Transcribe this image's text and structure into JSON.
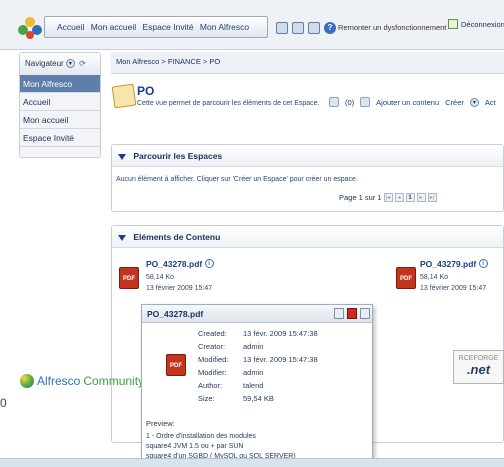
{
  "header": {
    "nav_links": [
      "Accueil",
      "Mon accueil",
      "Espace Invité",
      "Mon Alfresco"
    ],
    "report_link": "Remonter un dysfonctionnement",
    "logout_link": "Déconnexion"
  },
  "sidebar": {
    "navigator_label": "Navigateur",
    "items": [
      {
        "label": "Mon Alfresco",
        "active": true
      },
      {
        "label": "Accueil",
        "active": false
      },
      {
        "label": "Mon accueil",
        "active": false
      },
      {
        "label": "Espace Invité",
        "active": false
      }
    ]
  },
  "breadcrumb": "Mon Alfresco > FINANCE > PO",
  "space": {
    "title": "PO",
    "description": "Cette vue permet de parcourir les éléments de cet Espace.",
    "count": "(0)",
    "add_content": "Ajouter un contenu",
    "create": "Créer",
    "more": "Act"
  },
  "browse": {
    "title": "Parcourir les Espaces",
    "empty": "Aucun élément à afficher. Cliquer sur 'Créer un Espace' pour créer un espace.",
    "pager": "Page 1 sur 1"
  },
  "content": {
    "title": "Eléments de Contenu",
    "files": [
      {
        "name": "PO_43278.pdf",
        "size": "58,14 Ko",
        "date": "13 février 2009 15:47"
      },
      {
        "name": "PO_43279.pdf",
        "size": "58,14 Ko",
        "date": "13 février 2009 15:47"
      }
    ]
  },
  "popup": {
    "title": "PO_43278.pdf",
    "rows": [
      {
        "key": "Created:",
        "value": "13 févr. 2009 15:47:38"
      },
      {
        "key": "Creator:",
        "value": "admin"
      },
      {
        "key": "Modified:",
        "value": "13 févr. 2009 15:47:38"
      },
      {
        "key": "Modifier:",
        "value": "admin"
      },
      {
        "key": "Author:",
        "value": "talend"
      },
      {
        "key": "Size:",
        "value": "59,54 KB"
      }
    ],
    "preview_label": "Preview:",
    "preview_lines": [
      "1 - Ordre d'installation des modules",
      "square4 JVM 1.5 ou + par SUN",
      "square4 d'un SGBD ( MySQL ou SQL SERVER)"
    ]
  },
  "footer": {
    "community_brand": "Alfresco",
    "community_word": "Community",
    "forge_top": "RCEFORGE",
    "forge_bottom": ".net",
    "stray": "0"
  },
  "icons": {
    "file_type": "PDF"
  }
}
